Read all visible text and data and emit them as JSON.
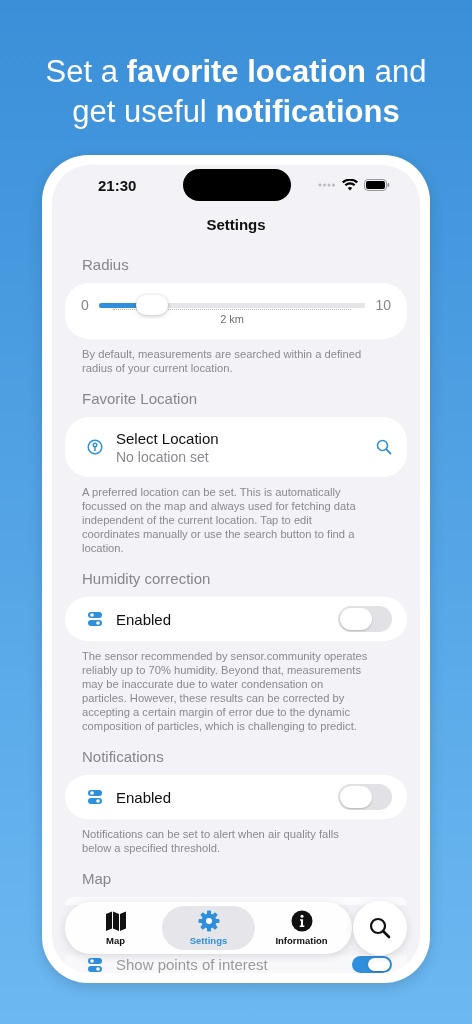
{
  "headline": "Set a **favorite location** and get useful **notifications**",
  "status_bar": {
    "time": "21:30"
  },
  "title": "Settings",
  "sections": [
    {
      "kind": "slider",
      "header": "Radius",
      "min_label": "0",
      "max_label": "10",
      "level": 0.2,
      "value_label": "2 km",
      "footer": "By default, measurements are searched within a defined radius of your current location."
    },
    {
      "kind": "location",
      "header": "Favorite Location",
      "title": "Select Location",
      "subtitle": "No location set",
      "footer": "A preferred location can be set. This is automatically focussed on the map and always used for fetching data independent of the current location. Tap to edit coordinates manually or use the search button to find a location."
    },
    {
      "kind": "toggle",
      "header": "Humidity correction",
      "label": "Enabled",
      "on": false,
      "footer": "The sensor recommended by sensor.community operates reliably up to 70% humidity. Beyond that, measurements may be inaccurate due to water condensation on particles. However, these results can be corrected by accepting a certain margin of error due to the dynamic composition of particles, which is challenging to predict."
    },
    {
      "kind": "toggle",
      "header": "Notifications",
      "label": "Enabled",
      "on": false,
      "footer": "Notifications can be set to alert when air quality falls below a specified threshold."
    },
    {
      "kind": "toggle",
      "header": "Map",
      "label": "Show points of interest",
      "on": true
    }
  ],
  "tab_bar": {
    "tabs": [
      {
        "label": "Map",
        "selected": false
      },
      {
        "label": "Settings",
        "selected": true
      },
      {
        "label": "Information",
        "selected": false
      }
    ]
  }
}
